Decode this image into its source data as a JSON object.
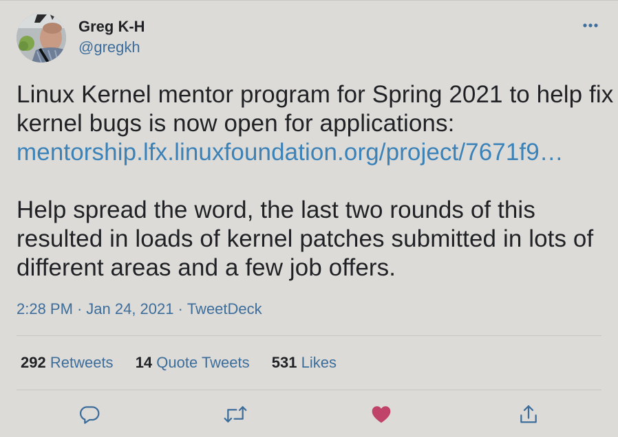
{
  "author": {
    "name": "Greg K-H",
    "handle": "@gregkh"
  },
  "tweet": {
    "line1": "Linux Kernel mentor program for Spring 2021 to help fix",
    "line2": "kernel bugs is now open for applications:",
    "link": "mentorship.lfx.linuxfoundation.org/project/7671f9…",
    "line4": "Help spread the word, the last two rounds of this",
    "line5": "resulted in loads of kernel patches submitted in lots of",
    "line6": "different areas and a few job offers."
  },
  "meta": {
    "time": "2:28 PM",
    "separator": "·",
    "date": "Jan 24, 2021",
    "source": "TweetDeck"
  },
  "stats": {
    "retweets_count": "292",
    "retweets_label": "Retweets",
    "quotes_count": "14",
    "quotes_label": "Quote Tweets",
    "likes_count": "531",
    "likes_label": "Likes"
  },
  "actions": {
    "reply_icon": "reply-icon",
    "retweet_icon": "retweet-icon",
    "like_icon": "heart-icon",
    "share_icon": "share-icon"
  },
  "colors": {
    "link": "#3b82b8",
    "secondary": "#3d6d9a",
    "like": "#c0436a",
    "background": "#dcdbd8"
  }
}
